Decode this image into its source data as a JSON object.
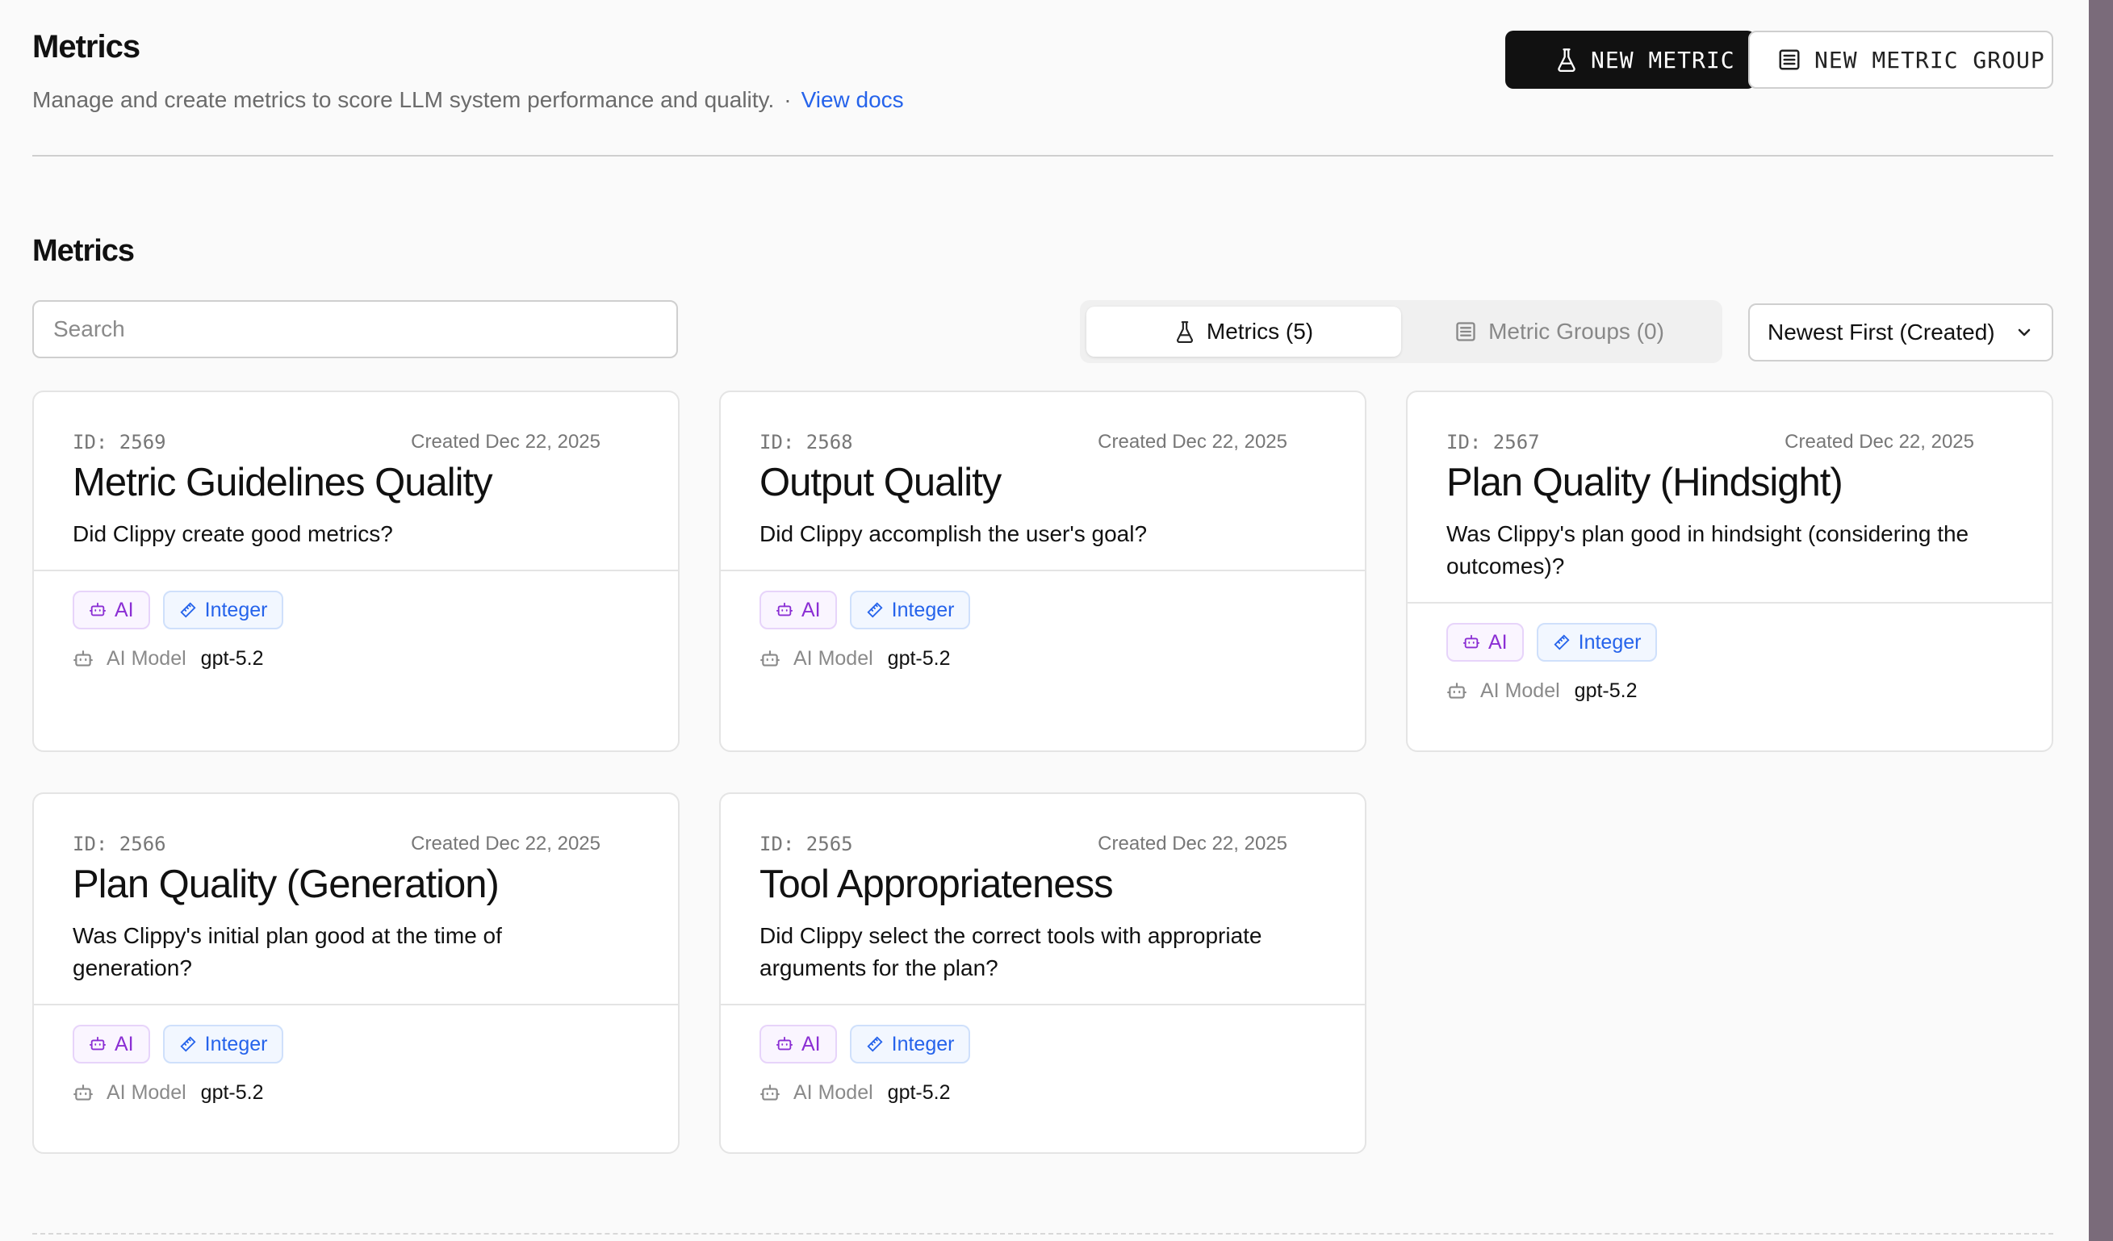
{
  "header": {
    "title": "Metrics",
    "subtitle": "Manage and create metrics to score LLM system performance and quality.",
    "separator": "·",
    "docs_link": "View docs",
    "new_metric_button": "NEW METRIC",
    "new_group_button": "NEW METRIC GROUP"
  },
  "section": {
    "title": "Metrics",
    "search_placeholder": "Search",
    "tabs": [
      {
        "label": "Metrics (5)",
        "icon": "flask-icon",
        "active": true
      },
      {
        "label": "Metric Groups (0)",
        "icon": "list-icon",
        "active": false
      }
    ],
    "sort": {
      "selected": "Newest First (Created)"
    }
  },
  "cards": [
    {
      "id": "ID: 2569",
      "created": "Created Dec 22, 2025",
      "name": "Metric Guidelines Quality",
      "description": "Did Clippy create good metrics?",
      "tags": [
        "AI",
        "Integer"
      ],
      "model_label": "AI Model",
      "model": "gpt-5.2"
    },
    {
      "id": "ID: 2568",
      "created": "Created Dec 22, 2025",
      "name": "Output Quality",
      "description": "Did Clippy accomplish the user's goal?",
      "tags": [
        "AI",
        "Integer"
      ],
      "model_label": "AI Model",
      "model": "gpt-5.2"
    },
    {
      "id": "ID: 2567",
      "created": "Created Dec 22, 2025",
      "name": "Plan Quality (Hindsight)",
      "description": "Was Clippy's plan good in hindsight (considering the outcomes)?",
      "tags": [
        "AI",
        "Integer"
      ],
      "model_label": "AI Model",
      "model": "gpt-5.2"
    },
    {
      "id": "ID: 2566",
      "created": "Created Dec 22, 2025",
      "name": "Plan Quality (Generation)",
      "description": "Was Clippy's initial plan good at the time of generation?",
      "tags": [
        "AI",
        "Integer"
      ],
      "model_label": "AI Model",
      "model": "gpt-5.2"
    },
    {
      "id": "ID: 2565",
      "created": "Created Dec 22, 2025",
      "name": "Tool Appropriateness",
      "description": "Did Clippy select the correct tools with appropriate arguments for the plan?",
      "tags": [
        "AI",
        "Integer"
      ],
      "model_label": "AI Model",
      "model": "gpt-5.2"
    }
  ],
  "colors": {
    "accent_link": "#2563eb",
    "primary_button": "#111111",
    "tag_ai": "#8b2fd4",
    "tag_integer": "#2563eb"
  }
}
